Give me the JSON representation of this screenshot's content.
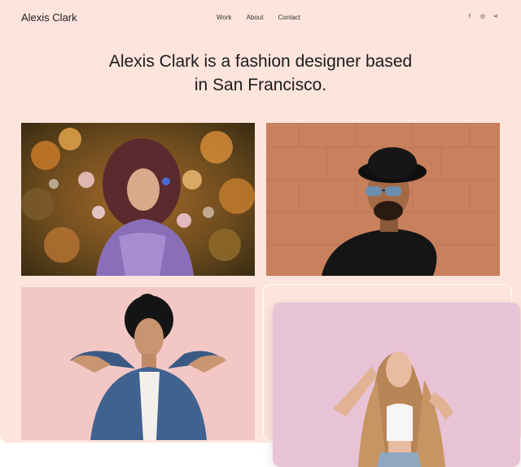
{
  "header": {
    "brand": "Alexis Clark",
    "nav": [
      "Work",
      "About",
      "Contact"
    ],
    "social": [
      {
        "icon": "facebook-icon",
        "glyph": "f"
      },
      {
        "icon": "instagram-icon",
        "glyph": "◎"
      },
      {
        "icon": "share-icon",
        "glyph": "⋖"
      }
    ]
  },
  "hero": {
    "line1": "Alexis Clark is a fashion designer based",
    "line2": "in San Francisco."
  },
  "colors": {
    "background": "#fde4dd",
    "text": "#1b1b1b"
  }
}
